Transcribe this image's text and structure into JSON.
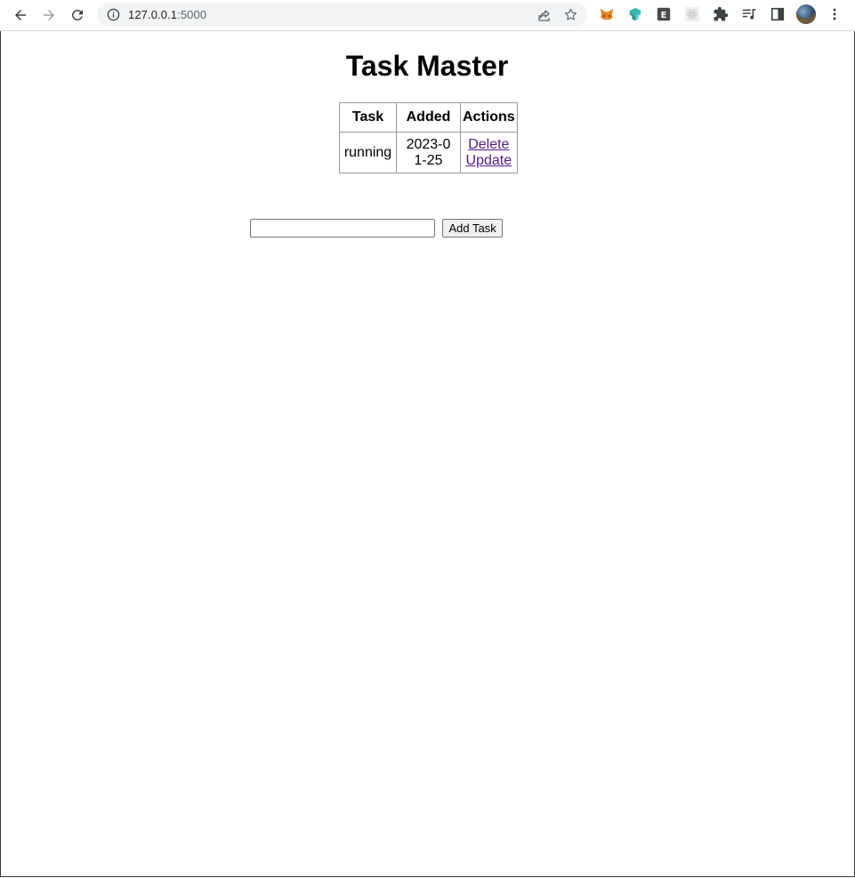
{
  "browser": {
    "url_host": "127.0.0.1",
    "url_port": ":5000",
    "icons": {
      "back": "back-arrow-icon",
      "forward": "forward-arrow-icon",
      "reload": "reload-icon",
      "site_info": "info-icon",
      "share": "share-icon",
      "bookmark": "star-icon",
      "extensions": [
        "metamask-fox-icon",
        "teal-cube-extension-icon",
        "e-extension-icon",
        "react-devtools-icon",
        "puzzle-extensions-icon",
        "media-queue-icon",
        "side-panel-icon"
      ],
      "profile": "avatar",
      "menu": "kebab-menu-icon"
    },
    "extension_e_label": "E"
  },
  "page": {
    "title": "Task Master",
    "table": {
      "headers": [
        "Task",
        "Added",
        "Actions"
      ],
      "rows": [
        {
          "task": "running",
          "added": "2023-01-25",
          "actions": [
            "Delete",
            "Update"
          ]
        }
      ]
    },
    "form": {
      "input_value": "",
      "button_label": "Add Task"
    }
  },
  "colors": {
    "link_visited": "#551a8b",
    "omnibox_bg": "#f1f3f4"
  }
}
